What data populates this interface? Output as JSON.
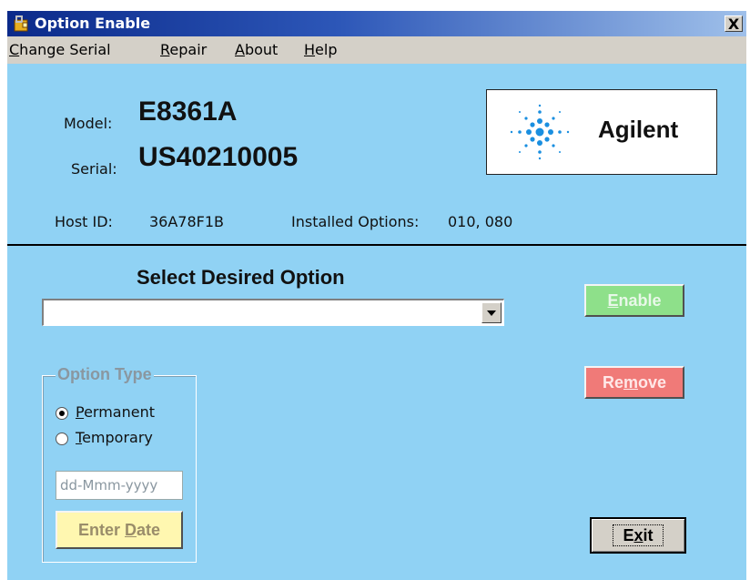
{
  "window": {
    "title": "Option Enable",
    "close_label": "X",
    "icon": "key-window-icon"
  },
  "menu": [
    {
      "pre": "",
      "u": "C",
      "post": "hange Serial"
    },
    {
      "pre": "",
      "u": "R",
      "post": "epair"
    },
    {
      "pre": "",
      "u": "A",
      "post": "bout"
    },
    {
      "pre": "",
      "u": "H",
      "post": "elp"
    }
  ],
  "instrument": {
    "model_label": "Model:",
    "model": "E8361A",
    "serial_label": "Serial:",
    "serial": "US40210005",
    "host_label": "Host ID:",
    "host_id": "36A78F1B",
    "options_label": "Installed Options:",
    "options": "010, 080"
  },
  "logo": {
    "text": "Agilent",
    "icon": "agilent-spark-logo"
  },
  "select": {
    "title": "Select Desired Option",
    "value": ""
  },
  "buttons": {
    "enable": {
      "pre": "",
      "u": "E",
      "post": "nable"
    },
    "remove": {
      "pre": "Re",
      "u": "m",
      "post": "ove"
    },
    "exit": {
      "pre": "E",
      "u": "x",
      "post": "it"
    },
    "enter_date": {
      "pre": "Enter ",
      "u": "D",
      "post": "ate"
    }
  },
  "option_type": {
    "title": "Option Type",
    "permanent": {
      "pre": "",
      "u": "P",
      "post": "ermanent",
      "checked": true
    },
    "temporary": {
      "pre": "",
      "u": "T",
      "post": "emporary",
      "checked": false
    },
    "date_placeholder": "dd-Mmm-yyyy"
  },
  "colors": {
    "background": "#90d2f4",
    "enable_button": "#8ee08a",
    "remove_button": "#f07a78",
    "enter_date_button": "#fff7b0"
  }
}
